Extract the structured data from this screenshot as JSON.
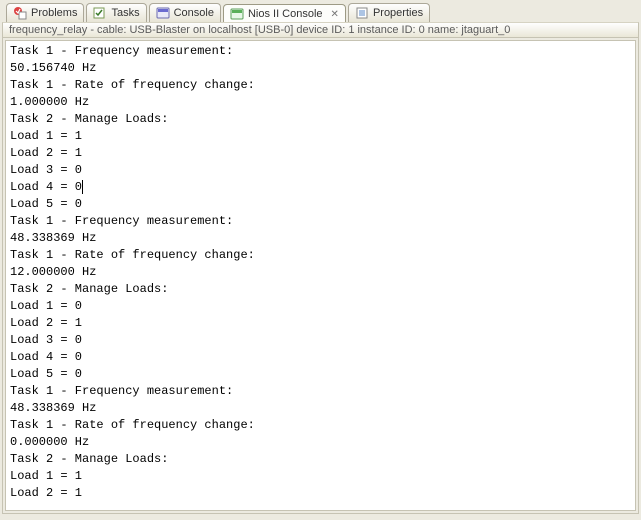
{
  "tabs": [
    {
      "label": "Problems",
      "icon": "problems-icon"
    },
    {
      "label": "Tasks",
      "icon": "tasks-icon"
    },
    {
      "label": "Console",
      "icon": "console-icon"
    },
    {
      "label": "Nios II Console",
      "icon": "nios-console-icon",
      "active": true,
      "closable": true
    },
    {
      "label": "Properties",
      "icon": "properties-icon"
    }
  ],
  "info_bar": "frequency_relay - cable: USB-Blaster on localhost [USB-0] device ID: 1 instance ID: 0 name: jtaguart_0",
  "console_lines": [
    "Task 1 - Frequency measurement:",
    "50.156740 Hz",
    "Task 1 - Rate of frequency change:",
    "1.000000 Hz",
    "Task 2 - Manage Loads:",
    "Load 1 = 1",
    "Load 2 = 1",
    "Load 3 = 0",
    "Load 4 = 0",
    "Load 5 = 0",
    "Task 1 - Frequency measurement:",
    "48.338369 Hz",
    "Task 1 - Rate of frequency change:",
    "12.000000 Hz",
    "Task 2 - Manage Loads:",
    "Load 1 = 0",
    "Load 2 = 1",
    "Load 3 = 0",
    "Load 4 = 0",
    "Load 5 = 0",
    "Task 1 - Frequency measurement:",
    "48.338369 Hz",
    "Task 1 - Rate of frequency change:",
    "0.000000 Hz",
    "Task 2 - Manage Loads:",
    "Load 1 = 1",
    "Load 2 = 1"
  ],
  "caret": {
    "line_index": 8,
    "col": 10
  }
}
